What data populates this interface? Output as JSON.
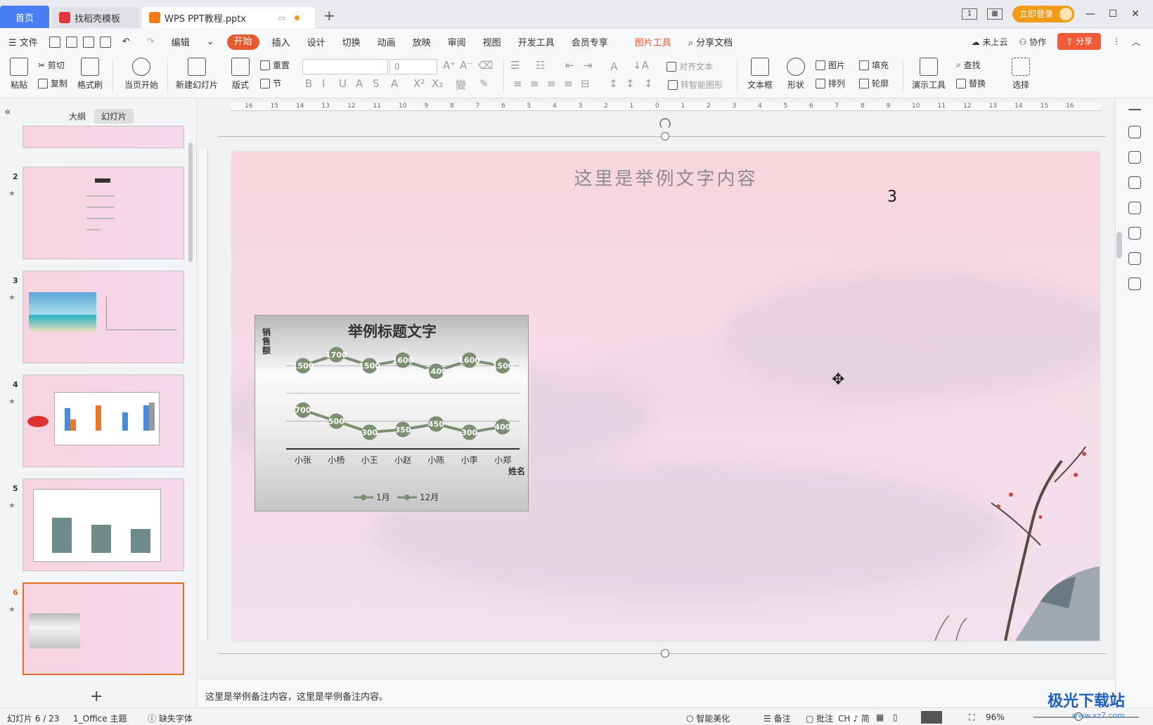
{
  "tabs": {
    "home": "首页",
    "templates": "找稻壳模板",
    "document": "WPS PPT教程.pptx",
    "add": "+"
  },
  "window": {
    "login": "立即登录"
  },
  "menu": {
    "file": "文件",
    "edit": "编辑",
    "start": "开始",
    "insert": "插入",
    "design": "设计",
    "switch": "切换",
    "animation": "动画",
    "slideshow": "放映",
    "review": "审阅",
    "view": "视图",
    "developer": "开发工具",
    "member": "会员专享",
    "picture_tools": "图片工具",
    "share_doc": "分享文档",
    "not_cloud": "未上云",
    "collab": "协作",
    "share": "分享"
  },
  "ribbon": {
    "paste": "粘贴",
    "cut": "剪切",
    "copy": "复制",
    "format_painter": "格式刷",
    "from_start": "当页开始",
    "new_slide": "新建幻灯片",
    "layout": "版式",
    "reset": "重置",
    "section": "节",
    "font_size": "0",
    "align_text": "对齐文本",
    "smart_shape": "转智能图形",
    "textbox": "文本框",
    "shape": "形状",
    "picture": "图片",
    "arrange": "排列",
    "fill": "填充",
    "outline": "轮廓",
    "present_tools": "演示工具",
    "find": "查找",
    "replace": "替换",
    "select": "选择"
  },
  "left_panel": {
    "outline_tab": "大纲",
    "slides_tab": "幻灯片",
    "thumbnails": [
      {
        "num": "2"
      },
      {
        "num": "3"
      },
      {
        "num": "4"
      },
      {
        "num": "5"
      },
      {
        "num": "6"
      }
    ],
    "add": "+"
  },
  "slide": {
    "title": "这里是举例文字内容",
    "number": "3"
  },
  "chart_data": {
    "type": "line",
    "title": "举例标题文字",
    "xlabel": "姓名",
    "ylabel": "销售额",
    "categories": [
      "小张",
      "小杨",
      "小王",
      "小赵",
      "小陈",
      "小李",
      "小郑"
    ],
    "series": [
      {
        "name": "1月",
        "values": [
          1500,
          1700,
          1500,
          1600,
          1400,
          1600,
          1500
        ]
      },
      {
        "name": "12月",
        "values": [
          700,
          500,
          300,
          350,
          450,
          300,
          400
        ]
      }
    ],
    "grid": true,
    "legend": "bottom",
    "color": "#7a9070"
  },
  "notes": {
    "text": "这里是举例备注内容，这里是举例备注内容。"
  },
  "status": {
    "slide_counter": "幻灯片 6 / 23",
    "theme": "1_Office 主题",
    "missing_font": "缺失字体",
    "beautify": "智能美化",
    "notes": "备注",
    "comment": "批注",
    "ime": "CH",
    "ime2": "简",
    "zoom": "96%"
  },
  "watermark": {
    "brand": "极光下载站",
    "url": "www.xz7.com"
  }
}
